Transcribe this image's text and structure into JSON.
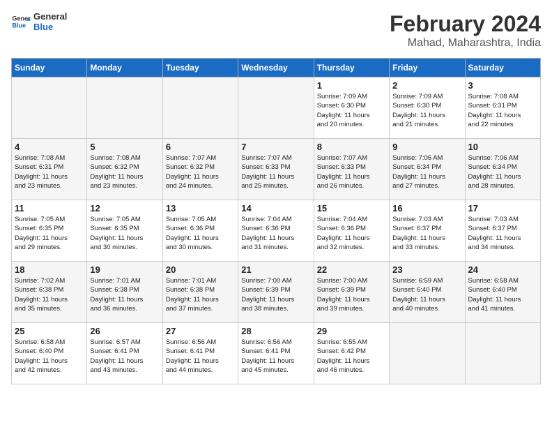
{
  "logo": {
    "line1": "General",
    "line2": "Blue"
  },
  "title": "February 2024",
  "subtitle": "Mahad, Maharashtra, India",
  "days_of_week": [
    "Sunday",
    "Monday",
    "Tuesday",
    "Wednesday",
    "Thursday",
    "Friday",
    "Saturday"
  ],
  "weeks": [
    [
      {
        "day": "",
        "info": ""
      },
      {
        "day": "",
        "info": ""
      },
      {
        "day": "",
        "info": ""
      },
      {
        "day": "",
        "info": ""
      },
      {
        "day": "1",
        "info": "Sunrise: 7:09 AM\nSunset: 6:30 PM\nDaylight: 11 hours\nand 20 minutes."
      },
      {
        "day": "2",
        "info": "Sunrise: 7:09 AM\nSunset: 6:30 PM\nDaylight: 11 hours\nand 21 minutes."
      },
      {
        "day": "3",
        "info": "Sunrise: 7:08 AM\nSunset: 6:31 PM\nDaylight: 11 hours\nand 22 minutes."
      }
    ],
    [
      {
        "day": "4",
        "info": "Sunrise: 7:08 AM\nSunset: 6:31 PM\nDaylight: 11 hours\nand 23 minutes."
      },
      {
        "day": "5",
        "info": "Sunrise: 7:08 AM\nSunset: 6:32 PM\nDaylight: 11 hours\nand 23 minutes."
      },
      {
        "day": "6",
        "info": "Sunrise: 7:07 AM\nSunset: 6:32 PM\nDaylight: 11 hours\nand 24 minutes."
      },
      {
        "day": "7",
        "info": "Sunrise: 7:07 AM\nSunset: 6:33 PM\nDaylight: 11 hours\nand 25 minutes."
      },
      {
        "day": "8",
        "info": "Sunrise: 7:07 AM\nSunset: 6:33 PM\nDaylight: 11 hours\nand 26 minutes."
      },
      {
        "day": "9",
        "info": "Sunrise: 7:06 AM\nSunset: 6:34 PM\nDaylight: 11 hours\nand 27 minutes."
      },
      {
        "day": "10",
        "info": "Sunrise: 7:06 AM\nSunset: 6:34 PM\nDaylight: 11 hours\nand 28 minutes."
      }
    ],
    [
      {
        "day": "11",
        "info": "Sunrise: 7:05 AM\nSunset: 6:35 PM\nDaylight: 11 hours\nand 29 minutes."
      },
      {
        "day": "12",
        "info": "Sunrise: 7:05 AM\nSunset: 6:35 PM\nDaylight: 11 hours\nand 30 minutes."
      },
      {
        "day": "13",
        "info": "Sunrise: 7:05 AM\nSunset: 6:36 PM\nDaylight: 11 hours\nand 30 minutes."
      },
      {
        "day": "14",
        "info": "Sunrise: 7:04 AM\nSunset: 6:36 PM\nDaylight: 11 hours\nand 31 minutes."
      },
      {
        "day": "15",
        "info": "Sunrise: 7:04 AM\nSunset: 6:36 PM\nDaylight: 11 hours\nand 32 minutes."
      },
      {
        "day": "16",
        "info": "Sunrise: 7:03 AM\nSunset: 6:37 PM\nDaylight: 11 hours\nand 33 minutes."
      },
      {
        "day": "17",
        "info": "Sunrise: 7:03 AM\nSunset: 6:37 PM\nDaylight: 11 hours\nand 34 minutes."
      }
    ],
    [
      {
        "day": "18",
        "info": "Sunrise: 7:02 AM\nSunset: 6:38 PM\nDaylight: 11 hours\nand 35 minutes."
      },
      {
        "day": "19",
        "info": "Sunrise: 7:01 AM\nSunset: 6:38 PM\nDaylight: 11 hours\nand 36 minutes."
      },
      {
        "day": "20",
        "info": "Sunrise: 7:01 AM\nSunset: 6:38 PM\nDaylight: 11 hours\nand 37 minutes."
      },
      {
        "day": "21",
        "info": "Sunrise: 7:00 AM\nSunset: 6:39 PM\nDaylight: 11 hours\nand 38 minutes."
      },
      {
        "day": "22",
        "info": "Sunrise: 7:00 AM\nSunset: 6:39 PM\nDaylight: 11 hours\nand 39 minutes."
      },
      {
        "day": "23",
        "info": "Sunrise: 6:59 AM\nSunset: 6:40 PM\nDaylight: 11 hours\nand 40 minutes."
      },
      {
        "day": "24",
        "info": "Sunrise: 6:58 AM\nSunset: 6:40 PM\nDaylight: 11 hours\nand 41 minutes."
      }
    ],
    [
      {
        "day": "25",
        "info": "Sunrise: 6:58 AM\nSunset: 6:40 PM\nDaylight: 11 hours\nand 42 minutes."
      },
      {
        "day": "26",
        "info": "Sunrise: 6:57 AM\nSunset: 6:41 PM\nDaylight: 11 hours\nand 43 minutes."
      },
      {
        "day": "27",
        "info": "Sunrise: 6:56 AM\nSunset: 6:41 PM\nDaylight: 11 hours\nand 44 minutes."
      },
      {
        "day": "28",
        "info": "Sunrise: 6:56 AM\nSunset: 6:41 PM\nDaylight: 11 hours\nand 45 minutes."
      },
      {
        "day": "29",
        "info": "Sunrise: 6:55 AM\nSunset: 6:42 PM\nDaylight: 11 hours\nand 46 minutes."
      },
      {
        "day": "",
        "info": ""
      },
      {
        "day": "",
        "info": ""
      }
    ]
  ]
}
